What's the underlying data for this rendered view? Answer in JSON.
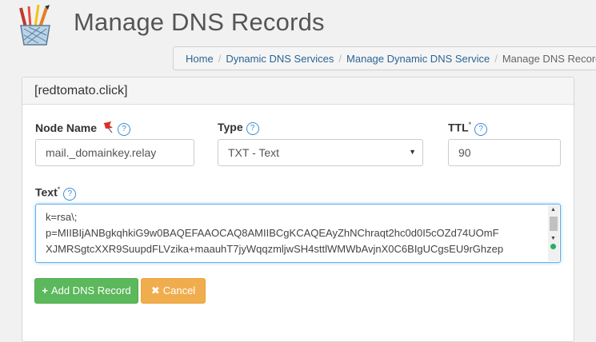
{
  "header": {
    "title": "Manage DNS Records",
    "logo_icon": "pencil-cup-icon"
  },
  "breadcrumb": {
    "items": [
      "Home",
      "Dynamic DNS Services",
      "Manage Dynamic DNS Service"
    ],
    "current": "Manage DNS Records"
  },
  "panel": {
    "heading": "[redtomato.click]"
  },
  "form": {
    "node_name": {
      "label": "Node Name",
      "value": "mail._domainkey.relay"
    },
    "type": {
      "label": "Type",
      "value": "TXT - Text"
    },
    "ttl": {
      "label": "TTL",
      "required_mark": "*",
      "value": "90"
    },
    "text": {
      "label": "Text",
      "required_mark": "*",
      "value": "k=rsa\\;\np=MIIBIjANBgkqhkiG9w0BAQEFAAOCAQ8AMIIBCgKCAQEAyZhNChraqt2hc0d0I5cOZd74UOmF\nXJMRSgtcXXR9SuupdFLVzika+maauhT7jyWqqzmljwSH4sttlWMWbAvjnX0C6BIgUCgsEU9rGhzep"
    },
    "help_icon": "?",
    "flag_icon": "pin-flag-icon"
  },
  "buttons": {
    "add": {
      "icon": "+",
      "label": "Add DNS Record"
    },
    "cancel": {
      "icon": "✖",
      "label": "Cancel"
    }
  },
  "colors": {
    "primary_link": "#2a6496",
    "success": "#5cb85c",
    "warning": "#f0ad4e",
    "focus": "#66afe9"
  }
}
